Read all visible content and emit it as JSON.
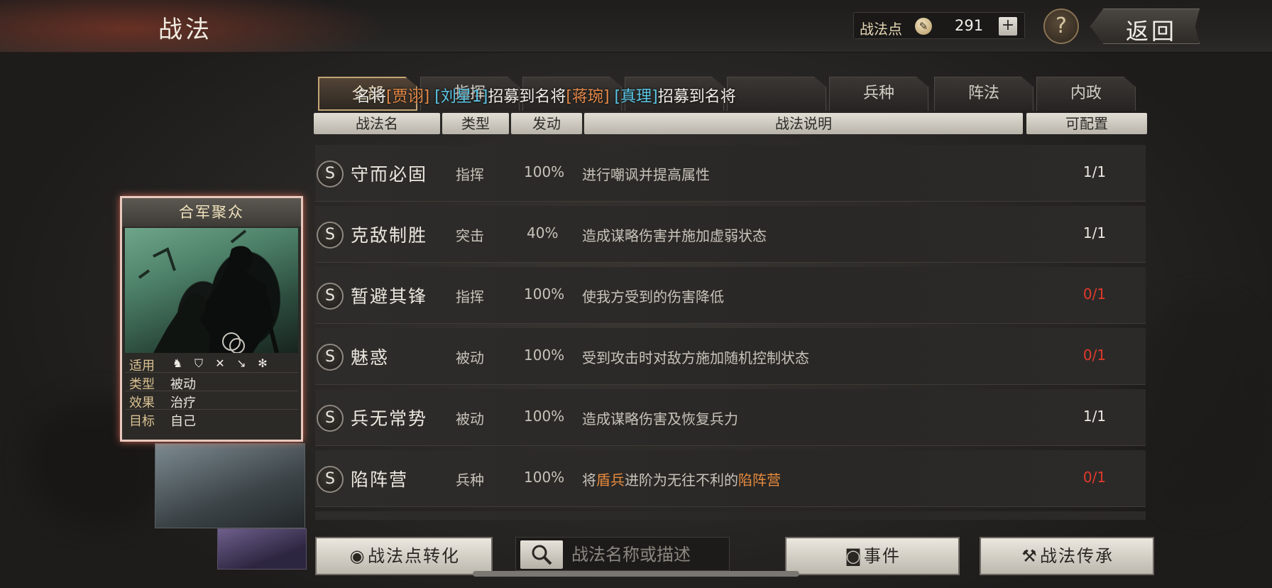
{
  "header": {
    "title": "战法",
    "points_label": "战法点",
    "points_value": "291",
    "plus_label": "+",
    "help_label": "?",
    "back_label": "返回"
  },
  "tabs": [
    {
      "label": "全部",
      "active": true
    },
    {
      "label": "指挥",
      "active": false
    },
    {
      "label": "",
      "active": false
    },
    {
      "label": "",
      "active": false
    },
    {
      "label": "",
      "active": false
    },
    {
      "label": "兵种",
      "active": false
    },
    {
      "label": "阵法",
      "active": false
    },
    {
      "label": "内政",
      "active": false
    }
  ],
  "ticker": {
    "p1": "名将",
    "n1": "[贾诩]",
    "p2": " ",
    "n2": "[刘星1]",
    "p3": "招募到名将",
    "n3": "[蒋琬]",
    "p4": "   ",
    "n4": "[真理]",
    "p5": "招募到名将"
  },
  "columns": {
    "name": "战法名",
    "type": "类型",
    "trigger": "发动",
    "desc": "战法说明",
    "quota": "可配置"
  },
  "rows": [
    {
      "grade": "S",
      "name": "守而必固",
      "type": "指挥",
      "rate": "100%",
      "desc": "进行嘲讽并提高属性",
      "quota": "1/1",
      "quota_red": false
    },
    {
      "grade": "S",
      "name": "克敌制胜",
      "type": "突击",
      "rate": "40%",
      "desc": "造成谋略伤害并施加虚弱状态",
      "quota": "1/1",
      "quota_red": false
    },
    {
      "grade": "S",
      "name": "暂避其锋",
      "type": "指挥",
      "rate": "100%",
      "desc": "使我方受到的伤害降低",
      "quota": "0/1",
      "quota_red": true
    },
    {
      "grade": "S",
      "name": "魅惑",
      "type": "被动",
      "rate": "100%",
      "desc": "受到攻击时对敌方施加随机控制状态",
      "quota": "0/1",
      "quota_red": true
    },
    {
      "grade": "S",
      "name": "兵无常势",
      "type": "被动",
      "rate": "100%",
      "desc": "造成谋略伤害及恢复兵力",
      "quota": "1/1",
      "quota_red": false
    },
    {
      "grade": "S",
      "name": "陷阵营",
      "type": "兵种",
      "rate": "100%",
      "desc_a": "将",
      "desc_b": "盾兵",
      "desc_c": "进阶为无往不利的",
      "desc_d": "陷阵营",
      "quota": "0/1",
      "quota_red": true
    }
  ],
  "card": {
    "title": "合军聚众",
    "apply_key": "适用",
    "type_key": "类型",
    "type_val": "被动",
    "effect_key": "效果",
    "effect_val": "治疗",
    "target_key": "目标",
    "target_val": "自己",
    "unit_icons": [
      "cavalry-icon",
      "shield-icon",
      "bow-icon",
      "spear-icon",
      "wheel-icon"
    ]
  },
  "bottom": {
    "convert_label": "战法点转化",
    "search_placeholder": "战法名称或描述",
    "event_label": "事件",
    "inherit_label": "战法传承"
  },
  "colors": {
    "quota_red": "#e03a2c",
    "highlight_orange": "#e68a3c",
    "ticker_cyan": "#5cc6e6"
  }
}
